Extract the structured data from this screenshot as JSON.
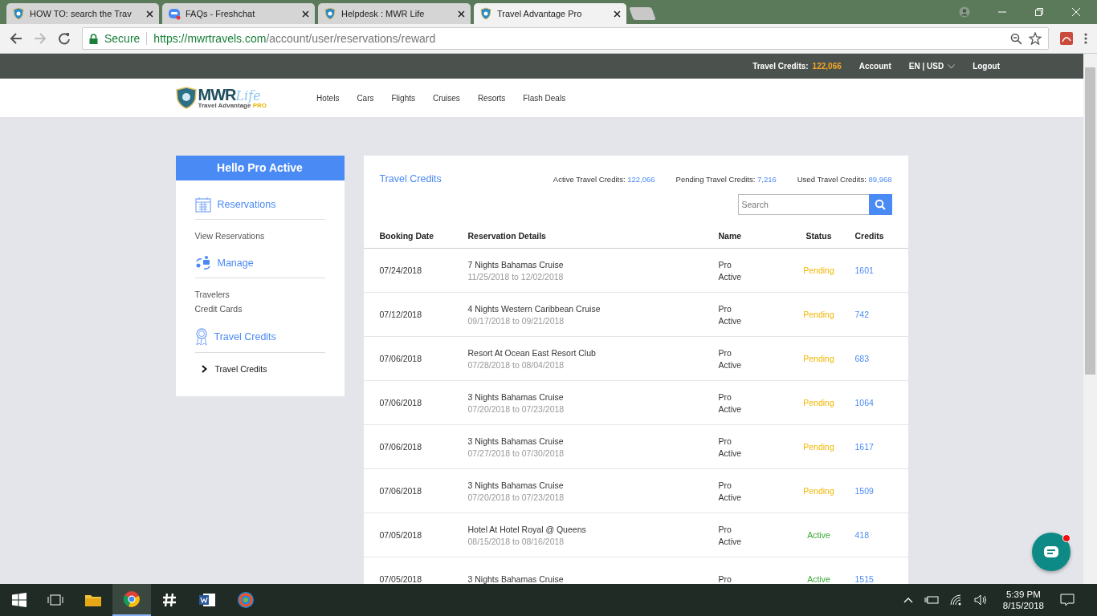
{
  "browser": {
    "tabs": [
      {
        "title": "HOW TO: search the Trav",
        "selected": false
      },
      {
        "title": "FAQs - Freshchat",
        "selected": false
      },
      {
        "title": "Helpdesk : MWR Life",
        "selected": false
      },
      {
        "title": "Travel Advantage Pro",
        "selected": true
      }
    ],
    "secure_label": "Secure",
    "url_host": "https://mwrtravels.com",
    "url_path": "/account/user/reservations/reward"
  },
  "top_bar": {
    "credits_label": "Travel Credits:",
    "credits_value": "122,066",
    "account": "Account",
    "locale": "EN | USD",
    "logout": "Logout"
  },
  "nav": {
    "logo_main": "MWR",
    "logo_script": "Life",
    "logo_sub": "Travel Advantage",
    "logo_pro": "PRO",
    "links": [
      "Hotels",
      "Cars",
      "Flights",
      "Cruises",
      "Resorts",
      "Flash Deals"
    ]
  },
  "sidebar": {
    "greeting": "Hello Pro Active",
    "sections": [
      {
        "title": "Reservations",
        "items": [
          {
            "label": "View Reservations",
            "selected": false
          }
        ]
      },
      {
        "title": "Manage",
        "items": [
          {
            "label": "Travelers",
            "selected": false
          },
          {
            "label": "Credit Cards",
            "selected": false
          }
        ]
      },
      {
        "title": "Travel Credits",
        "items": [
          {
            "label": "Travel Credits",
            "selected": true
          }
        ]
      }
    ]
  },
  "panel": {
    "title": "Travel Credits",
    "stats": [
      {
        "label": "Active Travel Credits:",
        "value": "122,066"
      },
      {
        "label": "Pending Travel Credits:",
        "value": "7,216"
      },
      {
        "label": "Used Travel Credits:",
        "value": "89,968"
      }
    ],
    "search": {
      "placeholder": "Search"
    },
    "table": {
      "columns": [
        "Booking Date",
        "Reservation Details",
        "Name",
        "Status",
        "Credits"
      ],
      "rows": [
        {
          "date": "07/24/2018",
          "title": "7 Nights Bahamas Cruise",
          "dates": "11/25/2018 to 12/02/2018",
          "name": [
            "Pro",
            "Active"
          ],
          "status": {
            "text": "Pending",
            "color": "#f2b600"
          },
          "credits": "1601"
        },
        {
          "date": "07/12/2018",
          "title": "4 Nights Western Caribbean Cruise",
          "dates": "09/17/2018 to 09/21/2018",
          "name": [
            "Pro",
            "Active"
          ],
          "status": {
            "text": "Pending",
            "color": "#f2b600"
          },
          "credits": "742"
        },
        {
          "date": "07/06/2018",
          "title": "Resort At Ocean East Resort Club",
          "dates": "07/28/2018 to 08/04/2018",
          "name": [
            "Pro",
            "Active"
          ],
          "status": {
            "text": "Pending",
            "color": "#f2b600"
          },
          "credits": "683"
        },
        {
          "date": "07/06/2018",
          "title": "3 Nights Bahamas Cruise",
          "dates": "07/20/2018 to 07/23/2018",
          "name": [
            "Pro",
            "Active"
          ],
          "status": {
            "text": "Pending",
            "color": "#f2b600"
          },
          "credits": "1064"
        },
        {
          "date": "07/06/2018",
          "title": "3 Nights Bahamas Cruise",
          "dates": "07/27/2018 to 07/30/2018",
          "name": [
            "Pro",
            "Active"
          ],
          "status": {
            "text": "Pending",
            "color": "#f2b600"
          },
          "credits": "1617"
        },
        {
          "date": "07/06/2018",
          "title": "3 Nights Bahamas Cruise",
          "dates": "07/20/2018 to 07/23/2018",
          "name": [
            "Pro",
            "Active"
          ],
          "status": {
            "text": "Pending",
            "color": "#f2b600"
          },
          "credits": "1509"
        },
        {
          "date": "07/05/2018",
          "title": "Hotel At Hotel Royal @ Queens",
          "dates": "08/15/2018 to 08/16/2018",
          "name": [
            "Pro",
            "Active"
          ],
          "status": {
            "text": "Active",
            "color": "#3aa935"
          },
          "credits": "418"
        },
        {
          "date": "07/05/2018",
          "title": "3 Nights Bahamas Cruise",
          "name": [
            "Pro"
          ],
          "status": {
            "text": "Active",
            "color": "#3aa935"
          },
          "credits": "1515"
        }
      ]
    }
  },
  "chat": {
    "unread": true
  },
  "taskbar": {
    "time": "5:39 PM",
    "date": "8/15/2018"
  }
}
